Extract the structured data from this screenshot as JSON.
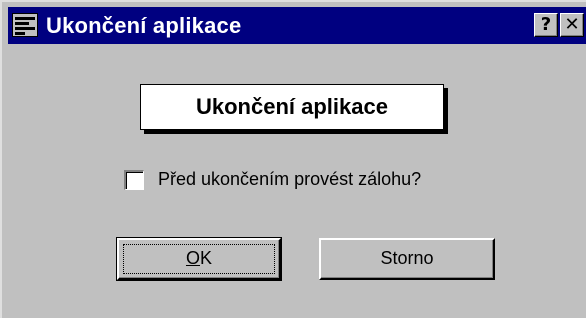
{
  "window": {
    "title": "Ukončení aplikace"
  },
  "titlebar": {
    "icon": "window-system-menu-icon",
    "help_label": "?",
    "close_label": "✕"
  },
  "banner": {
    "text": "Ukončení aplikace"
  },
  "backup_checkbox": {
    "label": "Před ukončením provést zálohu?",
    "checked": false
  },
  "buttons": {
    "ok_mnemonic": "O",
    "ok_rest": "K",
    "cancel_label": "Storno"
  },
  "colors": {
    "titlebar": "#000080",
    "face": "#c0c0c0"
  }
}
